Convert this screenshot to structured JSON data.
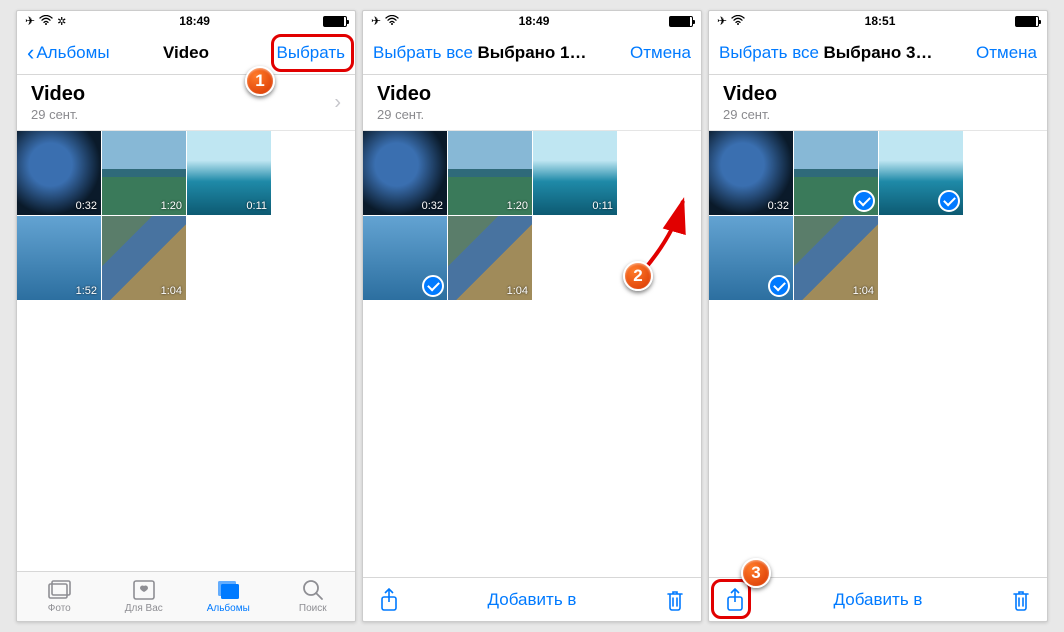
{
  "colors": {
    "ios_blue": "#007aff",
    "marker": "#e03c00",
    "red_box": "#e10000"
  },
  "markers": {
    "m1": "1",
    "m2": "2",
    "m3": "3"
  },
  "screens": [
    {
      "status": {
        "time": "18:49",
        "airplane": true
      },
      "nav": {
        "back": "Альбомы",
        "title": "Video",
        "right": "Выбрать"
      },
      "section": {
        "title": "Video",
        "subtitle": "29 сент."
      },
      "thumbs": [
        {
          "dur": "0:32",
          "cls": "t-earth",
          "checked": false
        },
        {
          "dur": "1:20",
          "cls": "t-beach",
          "checked": false
        },
        {
          "dur": "0:11",
          "cls": "t-sea",
          "checked": false
        },
        {
          "dur": "1:52",
          "cls": "t-dive",
          "checked": false
        },
        {
          "dur": "1:04",
          "cls": "t-coast",
          "checked": false
        }
      ],
      "tabs": [
        {
          "label": "Фото",
          "icon": "photos"
        },
        {
          "label": "Для Вас",
          "icon": "foryou"
        },
        {
          "label": "Альбомы",
          "icon": "albums",
          "active": true
        },
        {
          "label": "Поиск",
          "icon": "search"
        }
      ]
    },
    {
      "status": {
        "time": "18:49",
        "airplane": true
      },
      "nav": {
        "left": "Выбрать все",
        "title": "Выбрано 1…",
        "right": "Отмена"
      },
      "section": {
        "title": "Video",
        "subtitle": "29 сент."
      },
      "thumbs": [
        {
          "dur": "0:32",
          "cls": "t-earth",
          "checked": false
        },
        {
          "dur": "1:20",
          "cls": "t-beach",
          "checked": false
        },
        {
          "dur": "0:11",
          "cls": "t-sea",
          "checked": false
        },
        {
          "dur": "",
          "cls": "t-dive",
          "checked": true
        },
        {
          "dur": "1:04",
          "cls": "t-coast",
          "checked": false
        }
      ],
      "toolbar": {
        "share": true,
        "center": "Добавить в",
        "trash": true
      }
    },
    {
      "status": {
        "time": "18:51",
        "airplane": true
      },
      "nav": {
        "left": "Выбрать все",
        "title": "Выбрано 3…",
        "right": "Отмена"
      },
      "section": {
        "title": "Video",
        "subtitle": "29 сент."
      },
      "thumbs": [
        {
          "dur": "0:32",
          "cls": "t-earth",
          "checked": false
        },
        {
          "dur": "",
          "cls": "t-beach",
          "checked": true
        },
        {
          "dur": "",
          "cls": "t-sea",
          "checked": true
        },
        {
          "dur": "",
          "cls": "t-dive",
          "checked": true
        },
        {
          "dur": "1:04",
          "cls": "t-coast",
          "checked": false
        }
      ],
      "toolbar": {
        "share": true,
        "center": "Добавить в",
        "trash": true
      }
    }
  ]
}
